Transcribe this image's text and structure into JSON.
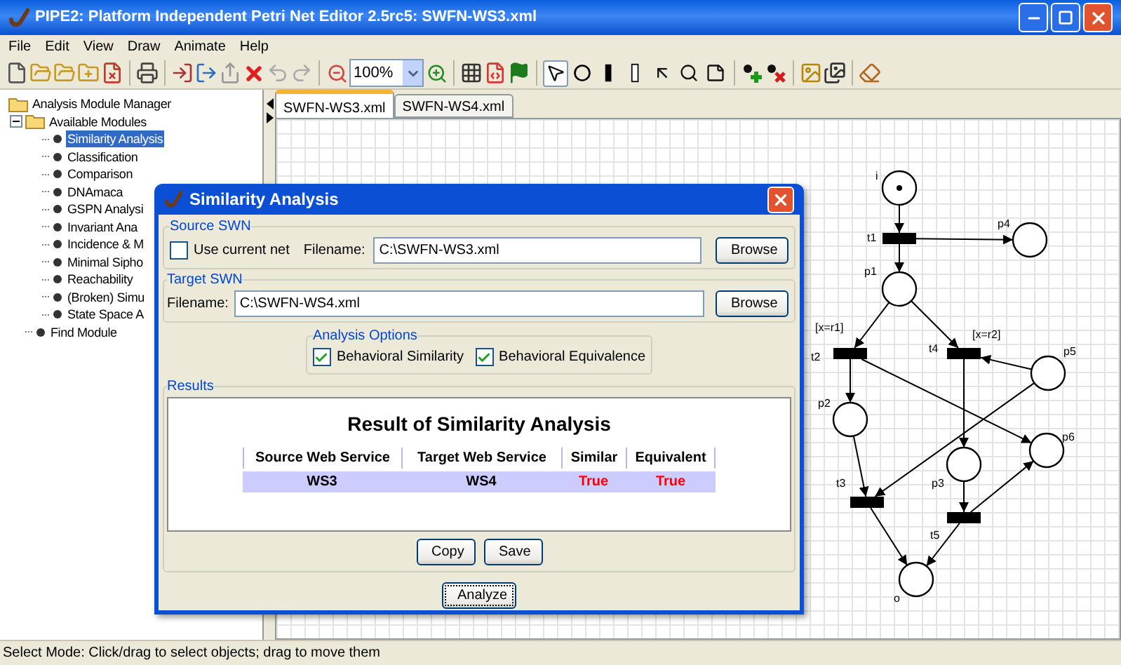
{
  "window": {
    "title": "PIPE2: Platform Independent Petri Net Editor 2.5rc5: SWFN-WS3.xml"
  },
  "menu": [
    "File",
    "Edit",
    "View",
    "Draw",
    "Animate",
    "Help"
  ],
  "toolbar": {
    "zoom": "100%",
    "drawing_tools": [
      {
        "selected": true
      },
      {
        "selected": false
      },
      {
        "selected": false
      },
      {
        "selected": false
      },
      {
        "selected": false
      },
      {
        "selected": false
      },
      {
        "selected": false
      }
    ]
  },
  "tree": {
    "label": "Analysis Module Manager",
    "kind": "folder",
    "children": [
      {
        "label": "Available Modules",
        "kind": "folder",
        "expanded": true,
        "children": [
          {
            "label": "Similarity Analysis",
            "kind": "module",
            "selected": true
          },
          {
            "label": "Classification",
            "kind": "module",
            "selected": false
          },
          {
            "label": "Comparison",
            "kind": "module",
            "selected": false
          },
          {
            "label": "DNAmaca",
            "kind": "module",
            "selected": false
          },
          {
            "label": "GSPN Analysi",
            "kind": "module",
            "selected": false
          },
          {
            "label": "Invariant Ana",
            "kind": "module",
            "selected": false
          },
          {
            "label": "Incidence & M",
            "kind": "module",
            "selected": false
          },
          {
            "label": "Minimal Sipho",
            "kind": "module",
            "selected": false
          },
          {
            "label": "Reachability",
            "kind": "module",
            "selected": false
          },
          {
            "label": "(Broken) Simu",
            "kind": "module",
            "selected": false
          },
          {
            "label": "State Space A",
            "kind": "module",
            "selected": false
          }
        ]
      },
      {
        "label": "Find Module",
        "kind": "module",
        "selected": false
      }
    ]
  },
  "tabs": [
    {
      "label": "SWFN-WS3.xml",
      "selected": true
    },
    {
      "label": "SWFN-WS4.xml",
      "selected": false
    }
  ],
  "net": {
    "places": [
      {
        "label": "i",
        "marked": true
      },
      {
        "label": "p4",
        "marked": false
      },
      {
        "label": "p1",
        "marked": false
      },
      {
        "label": "p5",
        "marked": false
      },
      {
        "label": "p2",
        "marked": false
      },
      {
        "label": "p6",
        "marked": false
      },
      {
        "label": "p3",
        "marked": false
      },
      {
        "label": "o",
        "marked": false
      }
    ],
    "transitions": [
      {
        "label": "t1"
      },
      {
        "label": "t2",
        "guard": "[x=r1]"
      },
      {
        "label": "t4",
        "guard": "[x=r2]"
      },
      {
        "label": "t3"
      },
      {
        "label": "t5"
      }
    ]
  },
  "dialog": {
    "title": "Similarity Analysis",
    "source": {
      "legend": "Source SWN",
      "checkbox": {
        "label": "Use current net",
        "checked": false
      },
      "filename_label": "Filename:",
      "filename": "C:\\SWFN-WS3.xml",
      "browse": "Browse"
    },
    "target": {
      "legend": "Target SWN",
      "filename_label": "Filename:",
      "filename": "C:\\SWFN-WS4.xml",
      "browse": "Browse"
    },
    "options": {
      "legend": "Analysis Options",
      "checkboxes": [
        {
          "label": "Behavioral Similarity",
          "checked": true
        },
        {
          "label": "Behavioral Equivalence",
          "checked": true
        }
      ]
    },
    "results": {
      "legend": "Results",
      "heading": "Result of Similarity Analysis",
      "columns": [
        "Source Web Service",
        "Target Web Service",
        "Similar",
        "Equivalent"
      ],
      "rows": [
        [
          {
            "text": "WS3",
            "color": "#000000"
          },
          {
            "text": "WS4",
            "color": "#000000"
          },
          {
            "text": "True",
            "color": "#ff0000"
          },
          {
            "text": "True",
            "color": "#ff0000"
          }
        ]
      ],
      "buttons": [
        "Copy",
        "Save"
      ]
    },
    "analyze": "Analyze"
  },
  "status_bar": "Select Mode: Click/drag to select objects; drag to move them"
}
